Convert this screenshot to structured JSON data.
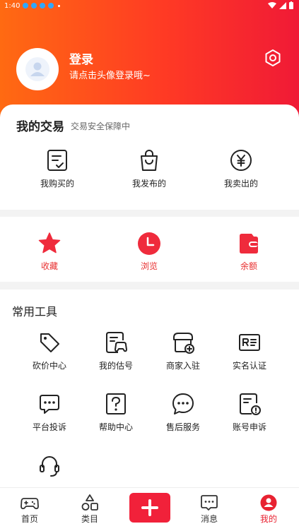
{
  "status": {
    "time": "1:40"
  },
  "user": {
    "title": "登录",
    "subtitle": "请点击头像登录哦~"
  },
  "trade": {
    "title": "我的交易",
    "subtitle": "交易安全保障中",
    "items": [
      {
        "label": "我购买的",
        "icon": "clipboard-check-icon"
      },
      {
        "label": "我发布的",
        "icon": "shopping-bag-icon"
      },
      {
        "label": "我卖出的",
        "icon": "yen-circle-icon"
      }
    ]
  },
  "quick": {
    "items": [
      {
        "label": "收藏",
        "icon": "star-icon"
      },
      {
        "label": "浏览",
        "icon": "clock-icon"
      },
      {
        "label": "余额",
        "icon": "wallet-icon"
      }
    ]
  },
  "tools": {
    "title": "常用工具",
    "items": [
      {
        "label": "砍价中心",
        "icon": "tag-icon"
      },
      {
        "label": "我的估号",
        "icon": "gamepad-card-icon"
      },
      {
        "label": "商家入驻",
        "icon": "store-add-icon"
      },
      {
        "label": "实名认证",
        "icon": "id-card-icon"
      },
      {
        "label": "平台投诉",
        "icon": "chat-dots-icon"
      },
      {
        "label": "帮助中心",
        "icon": "question-icon"
      },
      {
        "label": "售后服务",
        "icon": "chat-bubble-icon"
      },
      {
        "label": "账号申诉",
        "icon": "document-alert-icon"
      },
      {
        "label": "",
        "icon": "headset-icon"
      }
    ]
  },
  "nav": {
    "items": [
      {
        "label": "首页",
        "icon": "gamepad-icon"
      },
      {
        "label": "类目",
        "icon": "category-icon"
      },
      {
        "label": "消息",
        "icon": "message-icon"
      },
      {
        "label": "我的",
        "icon": "user-icon"
      }
    ]
  },
  "colors": {
    "accent": "#f1213a",
    "gradient_start": "#ff6a12",
    "gradient_end": "#f01a36"
  }
}
